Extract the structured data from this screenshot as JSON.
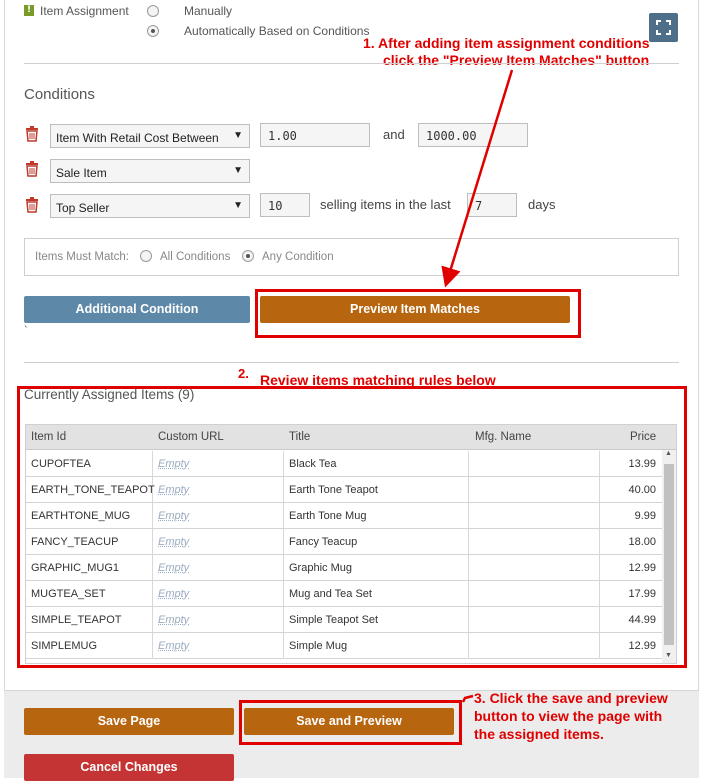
{
  "assignment": {
    "label": "Item Assignment",
    "options": [
      {
        "label": "Manually",
        "checked": false
      },
      {
        "label": "Automatically Based on Conditions",
        "checked": true
      }
    ]
  },
  "annotations": {
    "step1_line1": "1.  After adding item assignment conditions",
    "step1_line2": "click the \"Preview Item Matches\" button",
    "step2_num": "2.",
    "step2_text": "Review items matching rules below",
    "step3_line1": "3. Click the save and preview",
    "step3_line2": "button to view the page with",
    "step3_line3": "the assigned items.",
    "color": "#e00000"
  },
  "conditions": {
    "title": "Conditions",
    "rows": [
      {
        "select": "Item With Retail Cost Between",
        "value1": "1.00",
        "between_word": "and",
        "value2": "1000.00"
      },
      {
        "select": "Sale Item"
      },
      {
        "select": "Top Seller",
        "value1": "10",
        "mid_text": "selling items in the last",
        "value2": "7",
        "suffix": "days"
      }
    ],
    "match": {
      "label": "Items Must Match:",
      "options": [
        {
          "label": "All Conditions",
          "checked": false
        },
        {
          "label": "Any Condition",
          "checked": true
        }
      ]
    }
  },
  "buttons": {
    "additional_condition": "Additional Condition",
    "preview_matches": "Preview Item Matches",
    "save_page": "Save Page",
    "save_and_preview": "Save and Preview",
    "cancel_changes": "Cancel Changes"
  },
  "stray_char": "`",
  "assigned": {
    "title": "Currently Assigned Items (9)",
    "columns": [
      "Item Id",
      "Custom URL",
      "Title",
      "Mfg. Name",
      "Price"
    ],
    "rows": [
      {
        "id": "CUPOFTEA",
        "url": "Empty",
        "title": "Black Tea",
        "mfg": "",
        "price": "13.99"
      },
      {
        "id": "EARTH_TONE_TEAPOT",
        "url": "Empty",
        "title": "Earth Tone Teapot",
        "mfg": "",
        "price": "40.00"
      },
      {
        "id": "EARTHTONE_MUG",
        "url": "Empty",
        "title": "Earth Tone Mug",
        "mfg": "",
        "price": "9.99"
      },
      {
        "id": "FANCY_TEACUP",
        "url": "Empty",
        "title": "Fancy Teacup",
        "mfg": "",
        "price": "18.00"
      },
      {
        "id": "GRAPHIC_MUG1",
        "url": "Empty",
        "title": "Graphic Mug",
        "mfg": "",
        "price": "12.99"
      },
      {
        "id": "MUGTEA_SET",
        "url": "Empty",
        "title": "Mug and Tea Set",
        "mfg": "",
        "price": "17.99"
      },
      {
        "id": "SIMPLE_TEAPOT",
        "url": "Empty",
        "title": "Simple Teapot Set",
        "mfg": "",
        "price": "44.99"
      },
      {
        "id": "SIMPLEMUG",
        "url": "Empty",
        "title": "Simple Mug",
        "mfg": "",
        "price": "12.99"
      }
    ]
  },
  "colors": {
    "orange": "#b8650f",
    "blue": "#5d88a8",
    "red_button": "#c53434",
    "expand_button": "#4d6f8a"
  },
  "icons": [
    "info-icon",
    "expand-icon",
    "trash-icon",
    "chevron-down-icon",
    "scroll-up-icon",
    "scroll-down-icon"
  ]
}
